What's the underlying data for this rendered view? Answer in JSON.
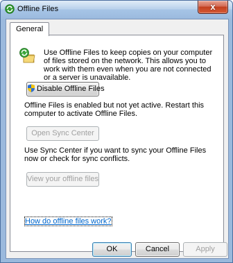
{
  "window": {
    "title": "Offline Files",
    "close_glyph": "x"
  },
  "tabs": [
    {
      "label": "General"
    }
  ],
  "general": {
    "description": "Use Offline Files to keep copies on your computer of files stored on the network. This allows you to work with them even when you are not connected or a server is unavailable.",
    "disable_button": "Disable Offline Files",
    "status_text": "Offline Files is enabled but not yet active.  Restart this computer to activate Offline Files.",
    "open_sync_button": "Open Sync Center",
    "sync_text": "Use Sync Center if you want to sync your Offline Files now or check for sync conflicts.",
    "view_files_button": "View your offline files",
    "help_link": "How do offline files work?"
  },
  "footer": {
    "ok_label": "OK",
    "cancel_label": "Cancel",
    "apply_label": "Apply"
  },
  "icons": {
    "title": "sync-center-icon",
    "feature": "sync-center-icon",
    "shield": "uac-shield-icon"
  },
  "colors": {
    "title_bar": "#a3c3e6",
    "close_button": "#c2401f",
    "link": "#0066cc"
  }
}
